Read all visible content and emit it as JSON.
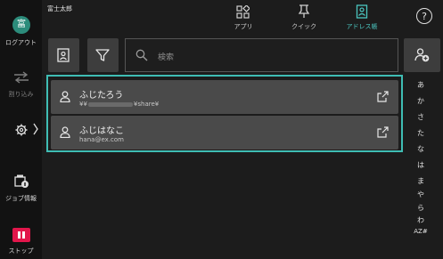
{
  "sidebar": {
    "avatar_char": "富",
    "logout_label": "ログアウト",
    "interrupt_label": "割り込み",
    "job_info_label": "ジョブ情報",
    "stop_label": "ストップ"
  },
  "header": {
    "user_name": "富士太郎",
    "tabs": [
      {
        "label": "アプリ",
        "icon": "apps-icon"
      },
      {
        "label": "クイック",
        "icon": "pin-icon"
      },
      {
        "label": "アドレス帳",
        "icon": "address-book-icon",
        "active": true
      }
    ],
    "help_label": "?"
  },
  "search": {
    "placeholder": "検索"
  },
  "contacts": [
    {
      "name": "ふじたろう",
      "address_prefix": "¥¥",
      "address_suffix": "¥share¥"
    },
    {
      "name": "ふじはなこ",
      "address": "hana@ex.com"
    }
  ],
  "index": [
    "あ",
    "か",
    "さ",
    "た",
    "な",
    "は",
    "ま",
    "や",
    "ら",
    "わ",
    "AZ#"
  ],
  "colors": {
    "accent": "#3fbdb4",
    "stop": "#e2164b",
    "avatar": "#2c8c7b"
  }
}
